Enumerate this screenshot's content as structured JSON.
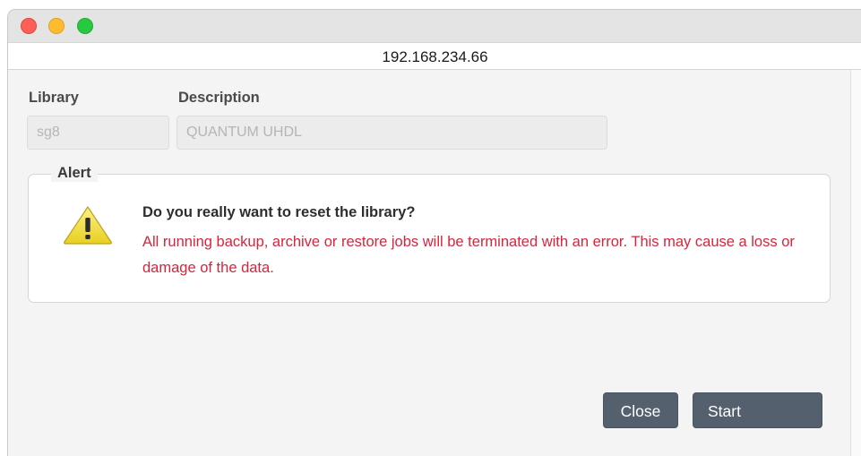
{
  "window": {
    "address": "192.168.234.66"
  },
  "form": {
    "library_label": "Library",
    "library_value": "sg8",
    "description_label": "Description",
    "description_value": "QUANTUM UHDL"
  },
  "alert": {
    "legend": "Alert",
    "icon": "warning-icon",
    "question": "Do you really want to reset the library?",
    "message": "All running backup, archive or restore jobs will be terminated with an error. This may cause a loss or damage of the data."
  },
  "buttons": {
    "close_label": "Close",
    "start_label": "Start"
  },
  "colors": {
    "error_text": "#d6253d",
    "button_bg": "#55606e",
    "warning_yellow": "#f3e03a"
  }
}
